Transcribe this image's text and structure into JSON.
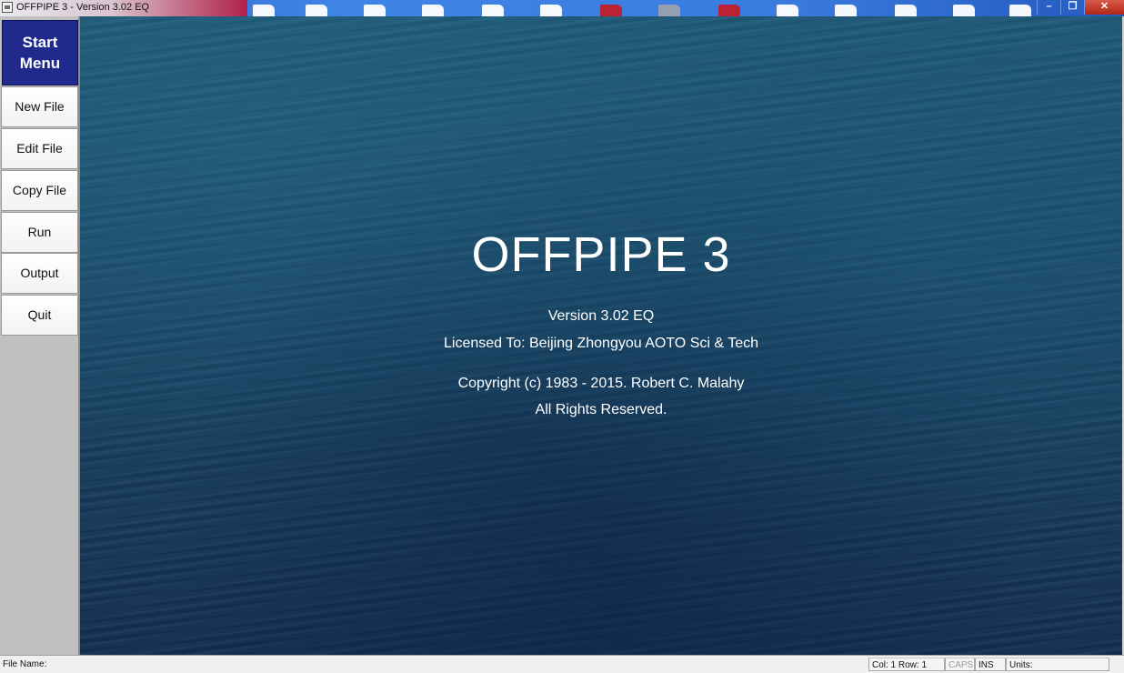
{
  "window": {
    "title": "OFFPIPE 3 - Version 3.02 EQ",
    "controls": {
      "minimize": "–",
      "restore": "❐",
      "close": "✕"
    }
  },
  "sidebar": {
    "start_menu_line1": "Start",
    "start_menu_line2": "Menu",
    "items": [
      {
        "label": "New File"
      },
      {
        "label": "Edit File"
      },
      {
        "label": "Copy File"
      },
      {
        "label": "Run"
      },
      {
        "label": "Output"
      },
      {
        "label": "Quit"
      }
    ]
  },
  "splash": {
    "title": "OFFPIPE 3",
    "version": "Version 3.02 EQ",
    "license": "Licensed To: Beijing Zhongyou AOTO Sci & Tech",
    "copyright": "Copyright (c) 1983 - 2015. Robert C. Malahy",
    "rights": "All Rights Reserved."
  },
  "statusbar": {
    "file_name_label": "File Name:",
    "position": "Col: 1 Row: 1",
    "caps": "CAPS",
    "ins": "INS",
    "units_label": "Units:"
  },
  "colors": {
    "start_menu_bg": "#1f2a8c",
    "ocean_bg": "#1b4e6d",
    "sidebar_bg": "#c0c0c0"
  }
}
